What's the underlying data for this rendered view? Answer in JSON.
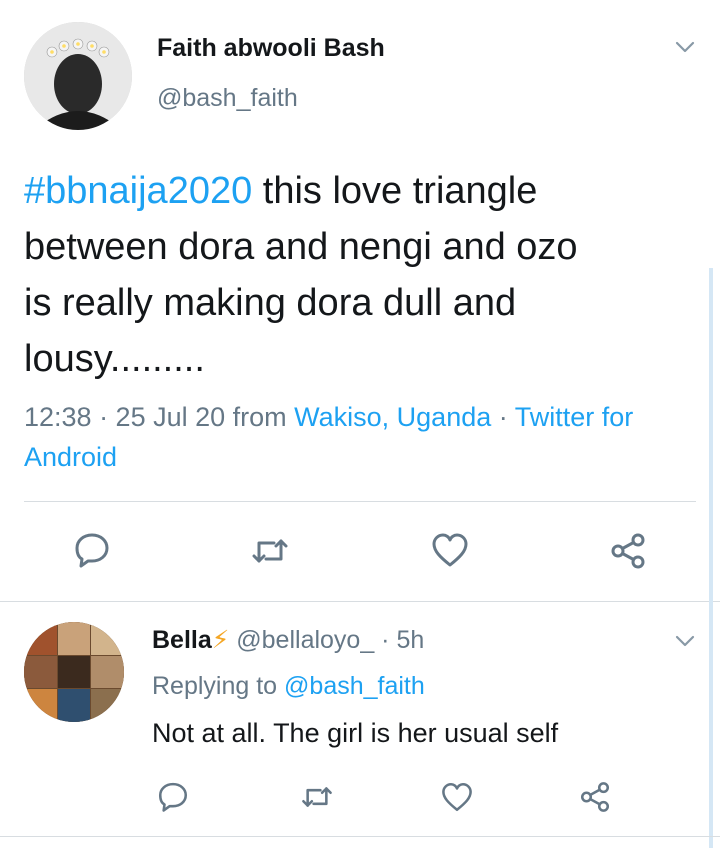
{
  "main_tweet": {
    "display_name": "Faith abwooli Bash",
    "handle": "@bash_faith",
    "hashtag": "#bbnaija2020",
    "text_lines": [
      " this love triangle",
      "between dora and nengi and ozo",
      "is really making dora dull and",
      "lousy........."
    ],
    "time": "12:38 · 25 Jul 20 from ",
    "location": "Wakiso, Uganda",
    "separator": " · ",
    "source_line1": "Twitter for",
    "source_line2": "Android"
  },
  "reply": {
    "display_name": "Bella",
    "emoji": "⚡",
    "handle_time": " @bellaloyo_ · 5h",
    "replying_prefix": "Replying to ",
    "replying_handle": "@bash_faith",
    "text": "Not at all. The girl is her usual self"
  },
  "icons": {
    "reply": "reply-icon",
    "retweet": "retweet-icon",
    "like": "heart-icon",
    "share": "share-icon",
    "more": "chevron-down-icon"
  },
  "colors": {
    "link": "#1da1f2",
    "secondary_text": "#657786",
    "icon": "#657786",
    "divider": "#d8dde1"
  }
}
